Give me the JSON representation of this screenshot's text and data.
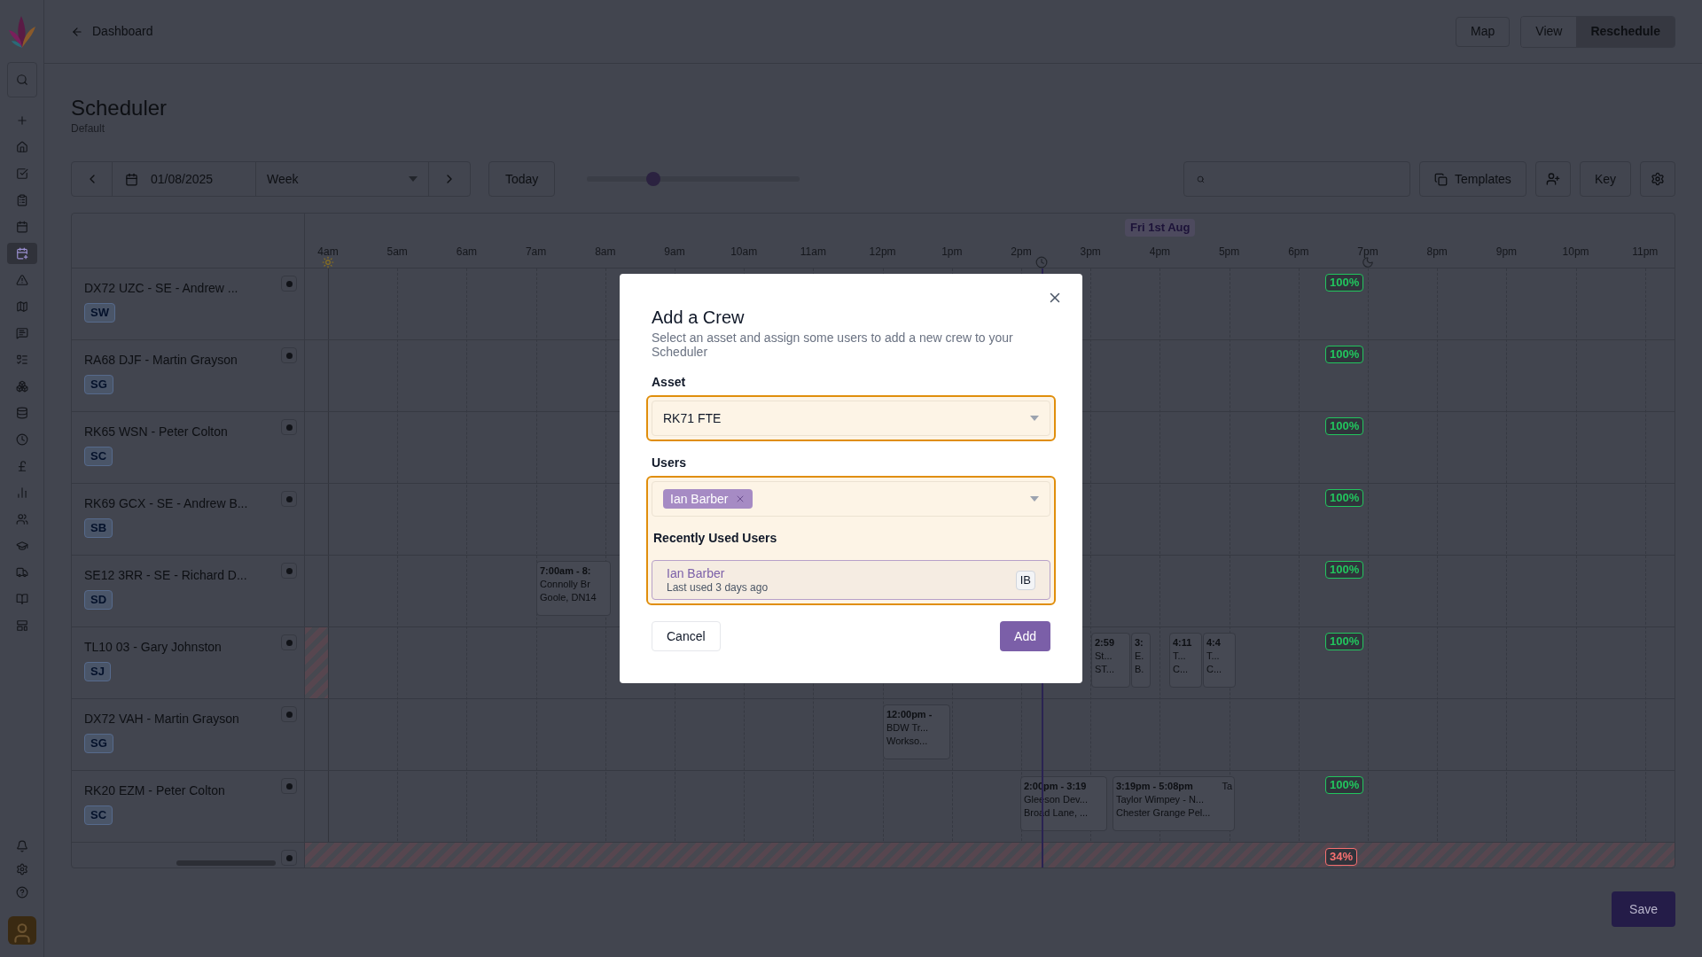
{
  "sidebar": {
    "items": [
      {
        "selected": false
      },
      {
        "selected": false
      },
      {
        "selected": false
      },
      {
        "selected": false
      },
      {
        "selected": false
      },
      {
        "selected": false
      },
      {
        "selected": true
      },
      {
        "selected": false
      },
      {
        "selected": false
      },
      {
        "selected": false
      },
      {
        "selected": false
      },
      {
        "selected": false
      },
      {
        "selected": false
      },
      {
        "selected": false
      },
      {
        "selected": false
      },
      {
        "selected": false
      },
      {
        "selected": false
      },
      {
        "selected": false
      },
      {
        "selected": false
      },
      {
        "selected": false
      },
      {
        "selected": false
      }
    ]
  },
  "top_bar": {
    "back_link": "Dashboard",
    "map_button": "Map",
    "view_toggle": [
      {
        "label": "View",
        "selected": false
      },
      {
        "label": "Reschedule",
        "selected": true
      }
    ]
  },
  "page": {
    "title": "Scheduler",
    "subtitle": "Default"
  },
  "toolbar": {
    "date": "01/08/2025",
    "range": "Week",
    "today": "Today",
    "zoom": {
      "level": 0.31
    },
    "templates": "Templates",
    "key": "Key"
  },
  "schedule": {
    "day_label": "Fri 1st Aug",
    "hours": [
      "4am",
      "5am",
      "6am",
      "7am",
      "8am",
      "9am",
      "10am",
      "11am",
      "12pm",
      "1pm",
      "2pm",
      "3pm",
      "4pm",
      "5pm",
      "6pm",
      "7pm",
      "8pm",
      "9pm",
      "10pm",
      "11pm"
    ],
    "crews": [
      {
        "name": "DX72 UZC - SE - Andrew ...",
        "initials": "SW",
        "utilisation": "100%",
        "color": "#22c55e",
        "unavailable": false,
        "early_unavailable": false
      },
      {
        "name": "RA68 DJF - Martin Grayson",
        "initials": "SG",
        "utilisation": "100%",
        "color": "#22c55e",
        "unavailable": false,
        "early_unavailable": false
      },
      {
        "name": "RK65 WSN - Peter Colton",
        "initials": "SC",
        "utilisation": "100%",
        "color": "#22c55e",
        "unavailable": false,
        "early_unavailable": false
      },
      {
        "name": "RK69 GCX - SE - Andrew B...",
        "initials": "SB",
        "utilisation": "100%",
        "color": "#22c55e",
        "unavailable": false,
        "early_unavailable": false
      },
      {
        "name": "SE12 3RR - SE - Richard D...",
        "initials": "SD",
        "utilisation": "100%",
        "color": "#22c55e",
        "unavailable": false,
        "early_unavailable": false,
        "events": [
          {
            "lines": [
              "7:00am - 8:",
              "Connolly Br",
              "Goole, DN14"
            ]
          }
        ]
      },
      {
        "name": "TL10 03 - Gary Johnston",
        "initials": "SJ",
        "utilisation": "100%",
        "color": "#22c55e",
        "unavailable": false,
        "early_unavailable": true,
        "events": [
          {
            "lines": [
              "2:59",
              "St...",
              "ST..."
            ]
          },
          {
            "lines": [
              "3:",
              "E.",
              "B."
            ]
          },
          {
            "lines": [
              "4:11",
              "T...",
              "C..."
            ]
          },
          {
            "lines": [
              "4:4",
              "T...",
              "C..."
            ]
          }
        ]
      },
      {
        "name": "DX72 VAH - Martin Grayson",
        "initials": "SG",
        "unavailable": false,
        "early_unavailable": false,
        "events": [
          {
            "lines": [
              "12:00pm -",
              "BDW Tr...",
              "Workso..."
            ]
          }
        ]
      },
      {
        "name": "RK20 EZM - Peter Colton",
        "initials": "SC",
        "utilisation": "100%",
        "color": "#22c55e",
        "unavailable": false,
        "early_unavailable": false,
        "events": [
          {
            "lines": [
              "2:00pm - 3:19",
              "Gleeson Dev...",
              "Broad Lane, ..."
            ]
          },
          {
            "lines": [
              "3:19pm - 5:08pm",
              "Taylor Wimpey - N...",
              "Chester Grange Pel..."
            ],
            "tag": "Ta"
          }
        ]
      },
      {
        "utilisation": "34%",
        "color": "#f87171",
        "unavailable": true,
        "early_unavailable": false
      }
    ]
  },
  "save_button": "Save",
  "modal": {
    "title": "Add a Crew",
    "description": "Select an asset and assign some users to add a new crew to your Scheduler",
    "asset": {
      "label": "Asset",
      "value": "RK71 FTE"
    },
    "users": {
      "label": "Users",
      "chips": [
        {
          "label": "Ian Barber"
        }
      ]
    },
    "recent": {
      "heading": "Recently Used Users",
      "items": [
        {
          "name": "Ian Barber",
          "subtitle": "Last used 3 days ago",
          "initials": "IB"
        }
      ]
    },
    "cancel": "Cancel",
    "add": "Add"
  }
}
